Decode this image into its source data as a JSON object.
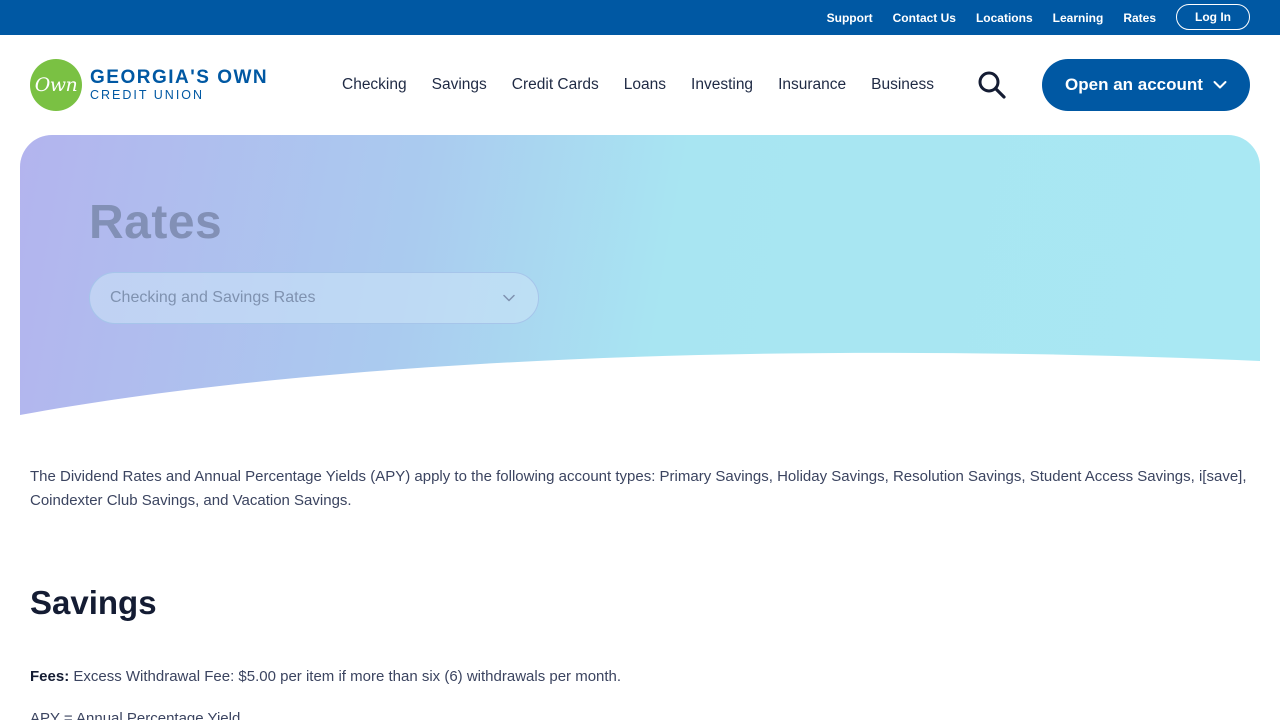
{
  "utility_nav": {
    "links": [
      "Support",
      "Contact Us",
      "Locations",
      "Learning",
      "Rates"
    ],
    "login_label": "Log In"
  },
  "logo": {
    "badge_text": "Own",
    "name": "GEORGIA'S OWN",
    "sub": "CREDIT UNION"
  },
  "main_nav": {
    "items": [
      "Checking",
      "Savings",
      "Credit Cards",
      "Loans",
      "Investing",
      "Insurance",
      "Business"
    ],
    "search_icon": "search-icon",
    "open_account_label": "Open an account"
  },
  "hero": {
    "title": "Rates",
    "select_value": "Checking and Savings Rates"
  },
  "content": {
    "intro": "The Dividend Rates and Annual Percentage Yields (APY) apply to the following account types: Primary Savings, Holiday Savings, Resolution Savings, Student Access Savings, i[save], Coindexter Club Savings, and Vacation Savings.",
    "section_title": "Savings",
    "fees_label": "Fees:",
    "fees_text": " Excess Withdrawal Fee: $5.00 per item if more than six (6) withdrawals per month.",
    "apy_text": "APY = Annual Percentage Yield"
  },
  "colors": {
    "brand_blue": "#0058a3",
    "brand_green": "#7ac143",
    "hero_start": "#b3b4ee",
    "hero_end": "#a9e8f3"
  }
}
